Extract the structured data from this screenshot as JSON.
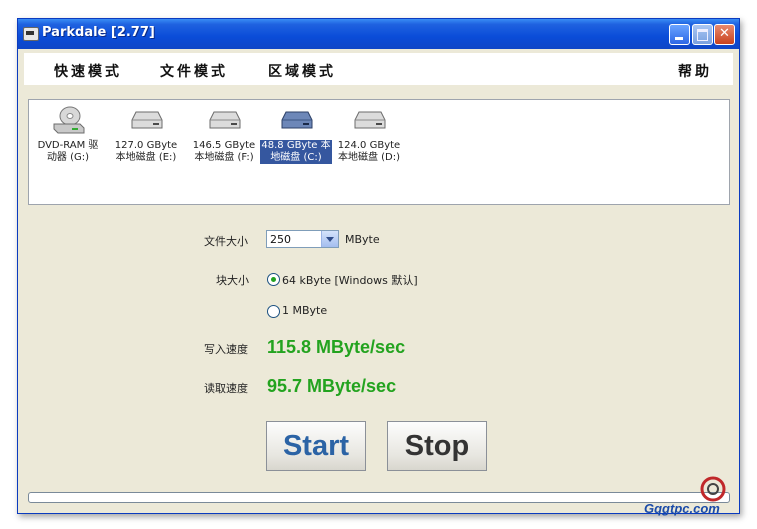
{
  "window": {
    "title": "Parkdale [2.77]"
  },
  "menu": {
    "quick": "快速模式",
    "file": "文件模式",
    "region": "区域模式",
    "help": "帮助"
  },
  "drives": [
    {
      "line1": "DVD-RAM 驱",
      "line2": "动器 (G:)",
      "icon": "optical-drive-icon",
      "selected": false
    },
    {
      "line1": "127.0 GByte",
      "line2": "本地磁盘 (E:)",
      "icon": "hard-disk-icon",
      "selected": false
    },
    {
      "line1": "146.5 GByte",
      "line2": "本地磁盘 (F:)",
      "icon": "hard-disk-icon",
      "selected": false
    },
    {
      "line1": "48.8 GByte 本",
      "line2": "地磁盘 (C:)",
      "icon": "hard-disk-icon",
      "selected": true
    },
    {
      "line1": "124.0 GByte",
      "line2": "本地磁盘 (D:)",
      "icon": "hard-disk-icon",
      "selected": false
    }
  ],
  "settings": {
    "file_size_label": "文件大小",
    "file_size_value": "250",
    "file_size_unit": "MByte",
    "block_size_label": "块大小",
    "block_option_1": "64 kByte [Windows 默认]",
    "block_option_2": "1 MByte",
    "block_selected": "64 kByte [Windows 默认]"
  },
  "results": {
    "write_label": "写入速度",
    "write_value": "115.8 MByte/sec",
    "read_label": "读取速度",
    "read_value": "95.7 MByte/sec"
  },
  "buttons": {
    "start": "Start",
    "stop": "Stop"
  },
  "progress": {
    "fraction": 0
  },
  "watermark": {
    "text": "Gqgtpc.com"
  },
  "colors": {
    "speed": "#23a31f",
    "selection": "#35579f",
    "start_text": "#2b63a5",
    "titlebar": "#0a4cd8"
  }
}
